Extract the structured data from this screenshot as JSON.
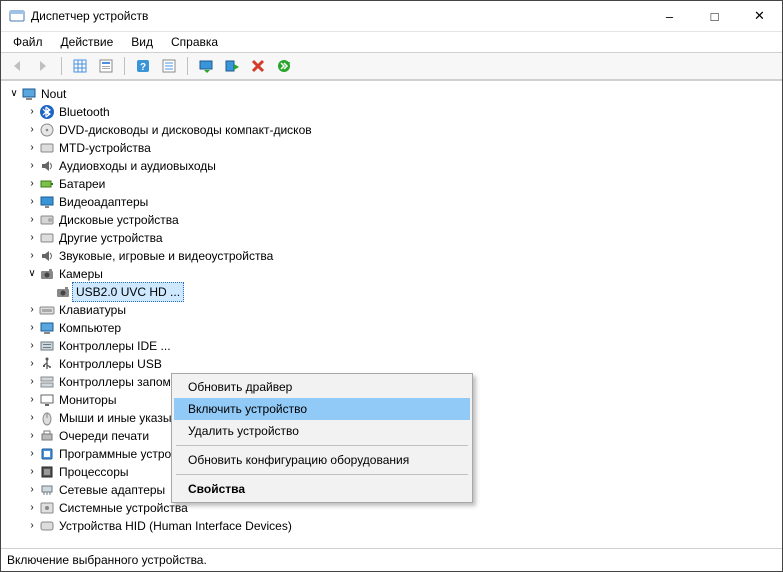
{
  "title": "Диспетчер устройств",
  "menus": {
    "file": "Файл",
    "action": "Действие",
    "view": "Вид",
    "help": "Справка"
  },
  "root": {
    "label": "Nout"
  },
  "categories": [
    {
      "key": "bluetooth",
      "label": "Bluetooth",
      "icon": "bluetooth-icon"
    },
    {
      "key": "dvd",
      "label": "DVD-дисководы и дисководы компакт-дисков",
      "icon": "disc-icon"
    },
    {
      "key": "mtd",
      "label": "MTD-устройства",
      "icon": "generic-icon"
    },
    {
      "key": "audio",
      "label": "Аудиовходы и аудиовыходы",
      "icon": "speaker-icon"
    },
    {
      "key": "battery",
      "label": "Батареи",
      "icon": "battery-icon"
    },
    {
      "key": "video",
      "label": "Видеоадаптеры",
      "icon": "display-icon"
    },
    {
      "key": "disk",
      "label": "Дисковые устройства",
      "icon": "drive-icon"
    },
    {
      "key": "other",
      "label": "Другие устройства",
      "icon": "generic-icon"
    },
    {
      "key": "avg",
      "label": "Звуковые, игровые и видеоустройства",
      "icon": "speaker-icon"
    },
    {
      "key": "cameras",
      "label": "Камеры",
      "icon": "camera-icon",
      "expanded": true,
      "children": [
        {
          "key": "cam0",
          "label": "USB2.0 UVC HD ...",
          "icon": "camera-icon",
          "selected": true
        }
      ]
    },
    {
      "key": "keyboards",
      "label": "Клавиатуры",
      "icon": "keyboard-icon"
    },
    {
      "key": "computer",
      "label": "Компьютер",
      "icon": "computer-icon"
    },
    {
      "key": "ide",
      "label": "Контроллеры IDE ...",
      "icon": "ide-icon"
    },
    {
      "key": "usbctl",
      "label": "Контроллеры USB",
      "icon": "usb-icon"
    },
    {
      "key": "storagectl",
      "label": "Контроллеры запоминающих устройств",
      "icon": "storage-icon"
    },
    {
      "key": "monitors",
      "label": "Мониторы",
      "icon": "monitor-icon"
    },
    {
      "key": "mice",
      "label": "Мыши и иные указывающие устройства",
      "icon": "mouse-icon"
    },
    {
      "key": "printq",
      "label": "Очереди печати",
      "icon": "printer-icon"
    },
    {
      "key": "software",
      "label": "Программные устройства",
      "icon": "software-icon"
    },
    {
      "key": "cpu",
      "label": "Процессоры",
      "icon": "cpu-icon"
    },
    {
      "key": "net",
      "label": "Сетевые адаптеры",
      "icon": "network-icon"
    },
    {
      "key": "system",
      "label": "Системные устройства",
      "icon": "system-icon"
    },
    {
      "key": "hid",
      "label": "Устройства HID (Human Interface Devices)",
      "icon": "hid-icon"
    }
  ],
  "context_menu": {
    "update": "Обновить драйвер",
    "enable": "Включить устройство",
    "uninstall": "Удалить устройство",
    "scan": "Обновить конфигурацию оборудования",
    "properties": "Свойства"
  },
  "status": "Включение выбранного устройства."
}
